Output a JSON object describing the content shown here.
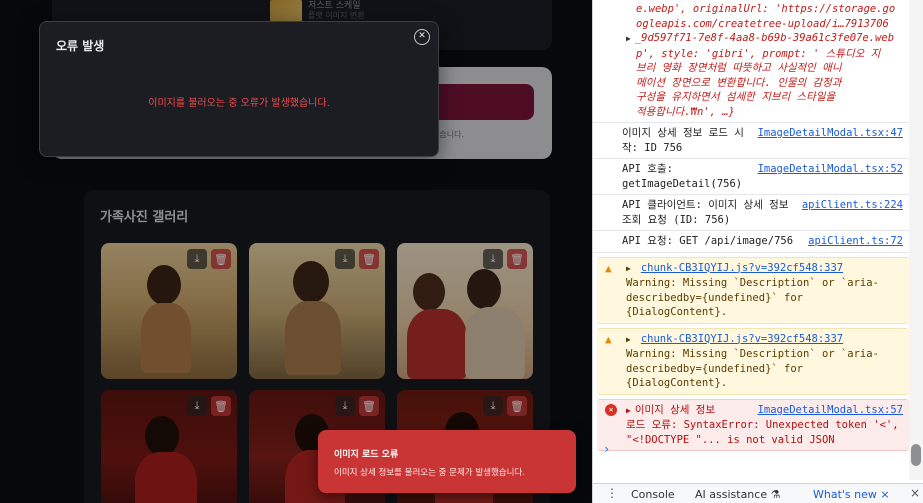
{
  "app": {
    "top_card_line1": "저스트 스케일",
    "top_card_line2": "플랫 이미지 변환",
    "form_note": "있습니다.",
    "gallery_title": "가족사진 갤러리",
    "tile_download_icon": "download-icon",
    "tile_delete_icon": "trash-icon"
  },
  "modal": {
    "title": "오류 발생",
    "message": "이미지를 불러오는 중 오류가 발생했습니다.",
    "close_icon": "close-icon"
  },
  "toast": {
    "title": "이미지 로드 오류",
    "body": "이미지 상세 정보를 불러오는 중 문제가 발생했습니다."
  },
  "devtools": {
    "object_lines": [
      "e.webp', originalUrl: 'https://storage.go",
      "ogleapis.com/createtree-upload/i…7913706",
      "_9d597f71-7e8f-4aa8-b69b-39a61c3fe07e.web",
      "p', style: 'gibri', prompt: ' 스튜디오 지",
      "브리 영화 장면처럼 따뜻하고 사실적인 애니",
      "메이션 장면으로 변환합니다. 인물의 감정과",
      "구성을 유지하면서 섬세한 지브리 스타일을",
      "적용합니다.₩n', …}"
    ],
    "logs": [
      {
        "text": "이미지 상세 정보 로드 시작: ID 756",
        "src": "ImageDetailModal.tsx:47"
      },
      {
        "text": "API 호출: getImageDetail(756)",
        "src": "ImageDetailModal.tsx:52"
      },
      {
        "text": "API 클라이언트: 이미지 상세 정보 조회 요청 (ID: 756)",
        "src": "apiClient.ts:224"
      },
      {
        "text": "API 요청: GET /api/image/756",
        "src": "apiClient.ts:72"
      }
    ],
    "warnings": [
      {
        "src": "chunk-CB3IQYIJ.js?v=392cf548:337",
        "text": "Warning: Missing `Description` or `aria-describedby={undefined}` for {DialogContent}."
      },
      {
        "src": "chunk-CB3IQYIJ.js?v=392cf548:337",
        "text": "Warning: Missing `Description` or `aria-describedby={undefined}` for {DialogContent}."
      }
    ],
    "error": {
      "head": "이미지 상세 정보",
      "src": "ImageDetailModal.tsx:57",
      "text": "로드 오류: SyntaxError: Unexpected token '<', \"<!DOCTYPE \"... is not valid JSON"
    },
    "prompt_symbol": "›",
    "tabs": {
      "kebab": "⋮",
      "console": "Console",
      "ai": "AI assistance ⚗",
      "whats_new": "What's new ×",
      "close": "×"
    }
  },
  "colors": {
    "toast_bg": "#c93535",
    "modal_bg": "#1b1d23",
    "error_text": "#ef4a4a",
    "link": "#1a5bd6"
  }
}
